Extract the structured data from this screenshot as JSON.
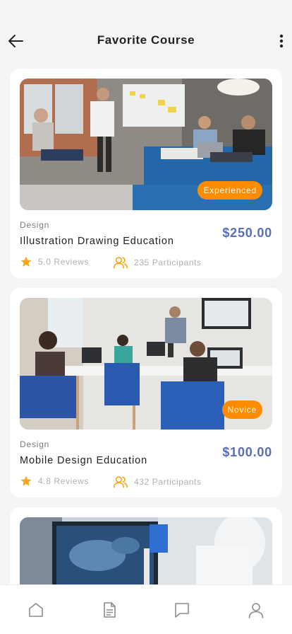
{
  "header": {
    "title": "Favorite Course",
    "back_icon": "arrow-left-icon",
    "more_icon": "more-vertical-icon"
  },
  "courses": [
    {
      "image": "photo of team meeting in office with whiteboard",
      "level": "Experienced",
      "category": "Design",
      "title": "Illustration Drawing Education",
      "price": "$250.00",
      "reviews": "5.0 Reviews",
      "participants": "235 Participants"
    },
    {
      "image": "photo of classroom with kids at computers",
      "level": "Novice",
      "category": "Design",
      "title": "Mobile Design Education",
      "price": "$100.00",
      "reviews": "4.8 Reviews",
      "participants": "432 Participants"
    },
    {
      "image": "photo of lab scientist with pipette and monitor"
    }
  ],
  "bottom_nav": {
    "items": [
      "home-icon",
      "document-icon",
      "chat-icon",
      "user-icon"
    ]
  },
  "colors": {
    "accent": "#ff8c00",
    "price": "#5a6eb3",
    "star": "#f5a623",
    "background": "#f5f5f5"
  }
}
